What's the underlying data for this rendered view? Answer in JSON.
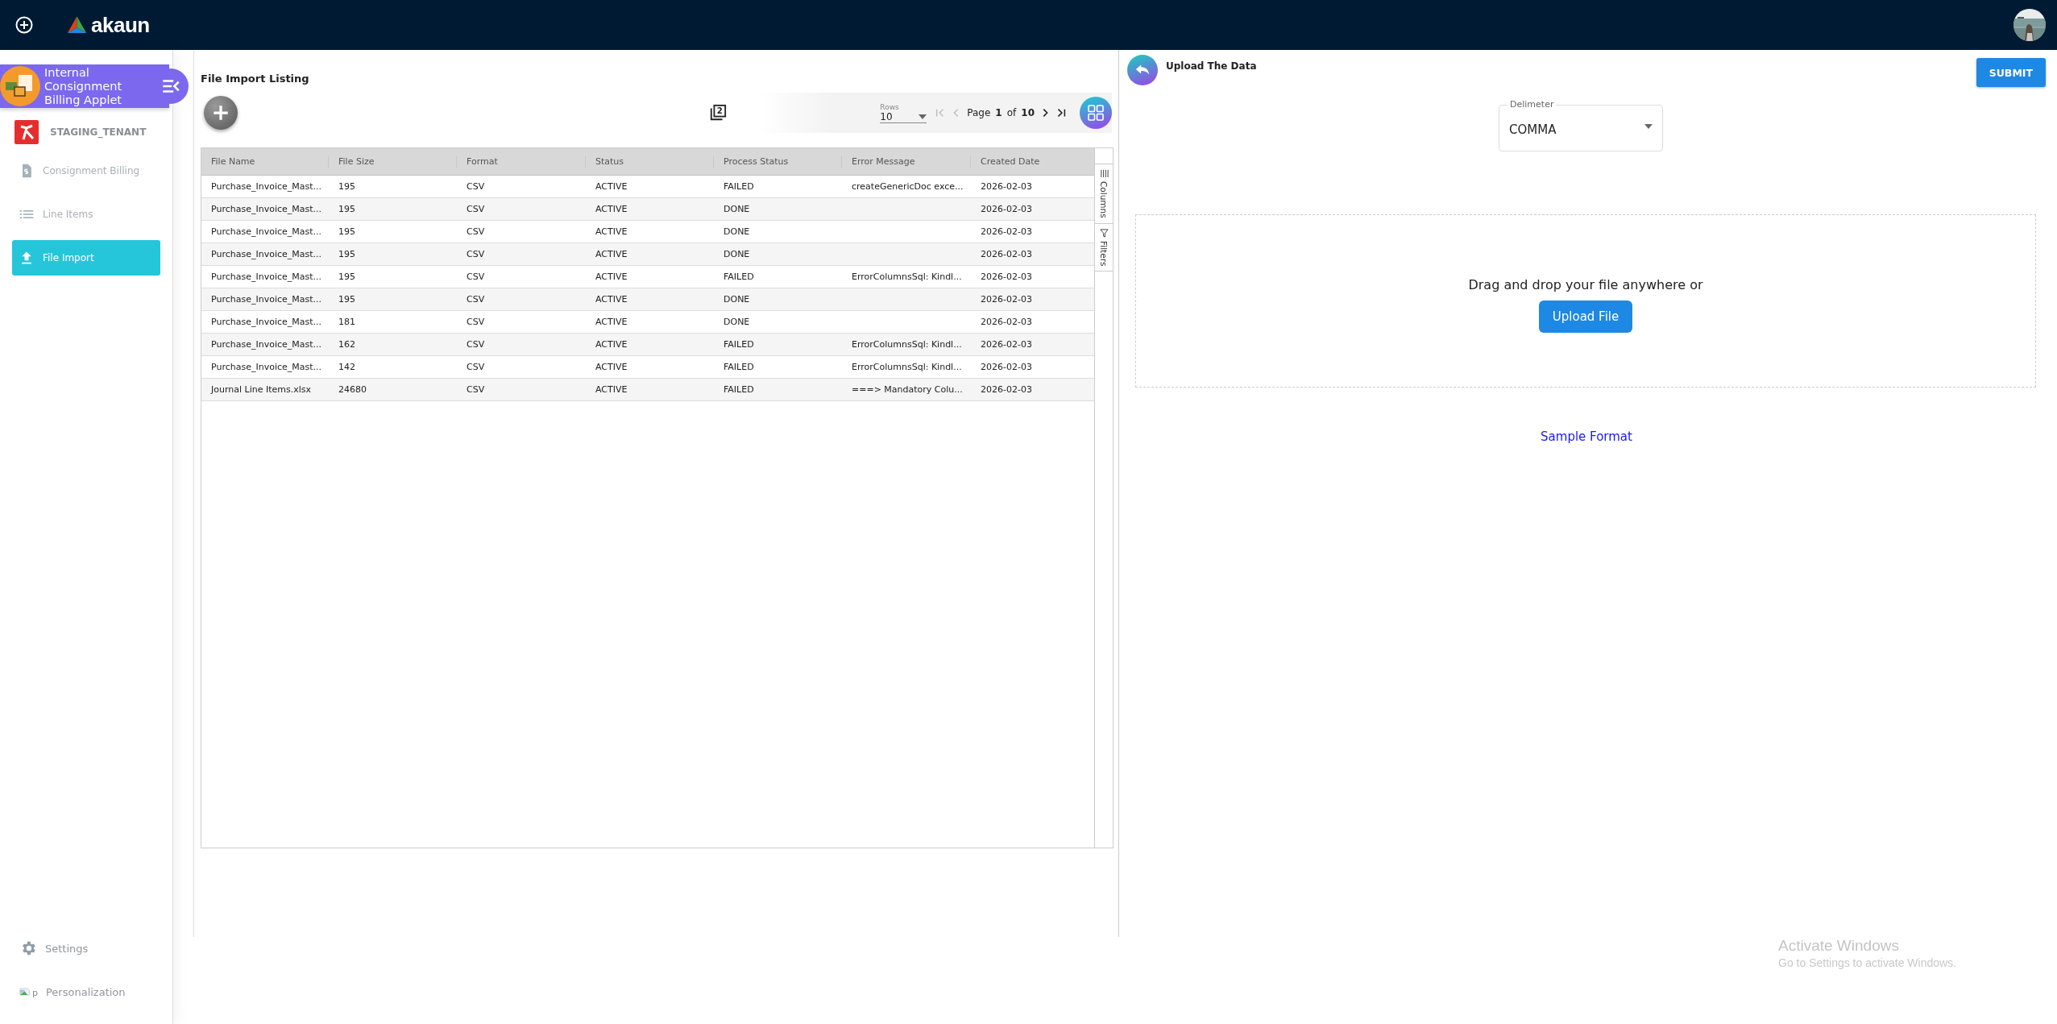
{
  "topbar": {
    "logo": "akaun"
  },
  "sidebar": {
    "applet": {
      "title": "Internal Consignment Billing Applet"
    },
    "tenant": "STAGING_TENANT",
    "items": [
      {
        "label": "Consignment Billing",
        "kind": "document",
        "selected": false
      },
      {
        "label": "Line Items",
        "kind": "list",
        "selected": false
      },
      {
        "label": "File Import",
        "kind": "upload",
        "selected": true
      }
    ],
    "footer": [
      {
        "label": "Settings",
        "kind": "gear"
      },
      {
        "label": "Personalization",
        "kind": "broken-image",
        "icon_alt": "p"
      }
    ]
  },
  "listing": {
    "title": "File Import Listing",
    "copies_badge": "2",
    "pagination": {
      "rows_label": "Rows",
      "rows": "10",
      "page_label": "Page",
      "page": "1",
      "of_label": "of",
      "total": "10"
    },
    "side_tabs": [
      {
        "label": "Columns",
        "kind": "columns"
      },
      {
        "label": "Filters",
        "kind": "filter"
      }
    ],
    "table": {
      "columns": [
        "File Name",
        "File Size",
        "Format",
        "Status",
        "Process Status",
        "Error Message",
        "Created Date"
      ],
      "rows": [
        [
          "Purchase_Invoice_Mast...",
          "195",
          "CSV",
          "ACTIVE",
          "FAILED",
          "createGenericDoc exce...",
          "2026-02-03"
        ],
        [
          "Purchase_Invoice_Mast...",
          "195",
          "CSV",
          "ACTIVE",
          "DONE",
          "",
          "2026-02-03"
        ],
        [
          "Purchase_Invoice_Mast...",
          "195",
          "CSV",
          "ACTIVE",
          "DONE",
          "",
          "2026-02-03"
        ],
        [
          "Purchase_Invoice_Mast...",
          "195",
          "CSV",
          "ACTIVE",
          "DONE",
          "",
          "2026-02-03"
        ],
        [
          "Purchase_Invoice_Mast...",
          "195",
          "CSV",
          "ACTIVE",
          "FAILED",
          "ErrorColumnsSql: Kindl...",
          "2026-02-03"
        ],
        [
          "Purchase_Invoice_Mast...",
          "195",
          "CSV",
          "ACTIVE",
          "DONE",
          "",
          "2026-02-03"
        ],
        [
          "Purchase_Invoice_Mast...",
          "181",
          "CSV",
          "ACTIVE",
          "DONE",
          "",
          "2026-02-03"
        ],
        [
          "Purchase_Invoice_Mast...",
          "162",
          "CSV",
          "ACTIVE",
          "FAILED",
          "ErrorColumnsSql: Kindl...",
          "2026-02-03"
        ],
        [
          "Purchase_Invoice_Mast...",
          "142",
          "CSV",
          "ACTIVE",
          "FAILED",
          "ErrorColumnsSql: Kindl...",
          "2026-02-03"
        ],
        [
          "Journal Line Items.xlsx",
          "24680",
          "CSV",
          "ACTIVE",
          "FAILED",
          "===> Mandatory Colu...",
          "2026-02-03"
        ]
      ]
    }
  },
  "upload": {
    "title": "Upload The Data",
    "submit": "SUBMIT",
    "delimiter": {
      "label": "Delimeter",
      "value": "COMMA"
    },
    "drop_text": "Drag and drop your file anywhere or",
    "upload_button": "Upload File",
    "sample_link": "Sample Format"
  },
  "os_notice": {
    "title": "Activate Windows",
    "text": "Go to Settings to activate Windows."
  }
}
